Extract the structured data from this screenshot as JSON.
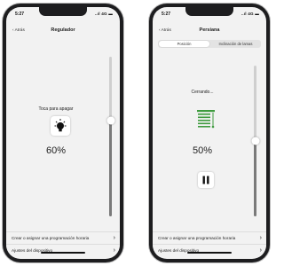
{
  "left_phone": {
    "status": {
      "time": "5:27",
      "icons": "..ıl 4G ▬"
    },
    "nav": {
      "back_label": "‹ Atrás",
      "title": "Regulador"
    },
    "main": {
      "hint": "Toca para apagar",
      "icon": "bulb-icon",
      "percent": "60%"
    },
    "slider": {
      "level": 0.6
    },
    "rows": [
      {
        "label": "Crear o asignar una programación horaria"
      },
      {
        "label": "Ajustes del dispositivo"
      }
    ]
  },
  "right_phone": {
    "status": {
      "time": "5:27",
      "icons": "..ıl 4G ▬"
    },
    "nav": {
      "back_label": "‹ Atrás",
      "title": "Persiana"
    },
    "tabs": [
      {
        "label": "Posición"
      },
      {
        "label": "Inclinación de lamas"
      }
    ],
    "main": {
      "status_text": "Cerrando...",
      "icon": "blinds-icon",
      "percent": "50%",
      "pause_icon": "pause-icon"
    },
    "slider": {
      "level": 0.5
    },
    "rows": [
      {
        "label": "Crear o asignar una programación horaria"
      },
      {
        "label": "Ajustes del dispositivo"
      }
    ]
  },
  "colors": {
    "accent": "#3e9b3e",
    "background": "#f2f2f2"
  }
}
